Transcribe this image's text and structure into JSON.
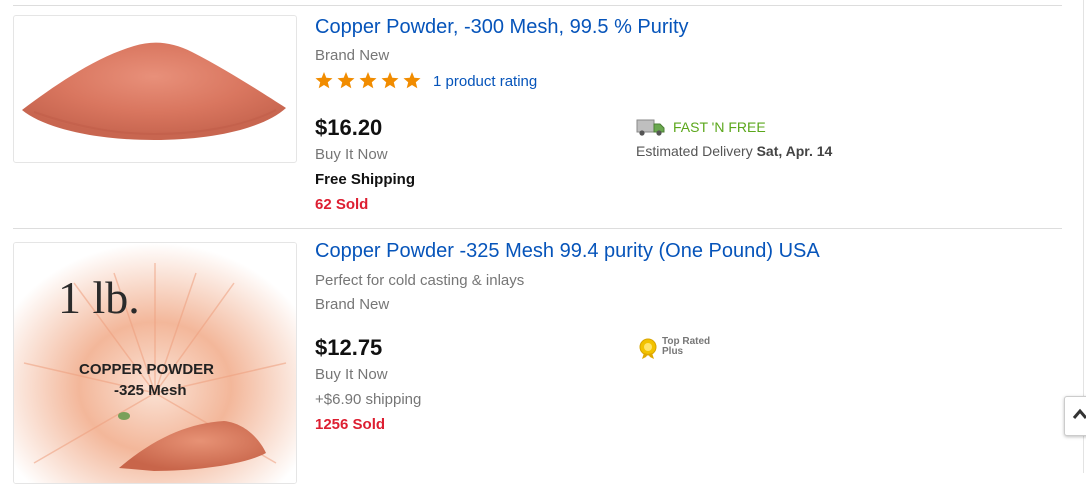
{
  "listings": [
    {
      "title": "Copper Powder, -300 Mesh, 99.5 % Purity",
      "condition": "Brand New",
      "rating_stars": 5,
      "rating_text": "1 product rating",
      "price": "$16.20",
      "format": "Buy It Now",
      "shipping": "Free Shipping",
      "sold": "62 Sold",
      "fast_label": "FAST 'N FREE",
      "delivery_prefix": "Estimated Delivery",
      "delivery_date": "Sat, Apr. 14"
    },
    {
      "title": "Copper Powder -325 Mesh 99.4 purity (One Pound) USA",
      "subtitle": "Perfect for cold casting & inlays",
      "condition": "Brand New",
      "price": "$12.75",
      "format": "Buy It Now",
      "shipping": "+$6.90 shipping",
      "sold": "1256 Sold",
      "badge_line1": "Top Rated",
      "badge_line2": "Plus",
      "image_text": {
        "weight": "1 lb.",
        "product": "COPPER POWDER",
        "mesh": "-325 Mesh"
      }
    }
  ],
  "colors": {
    "link": "#0654ba",
    "sold": "#dd1e31",
    "star": "#f18c00",
    "fast": "#5ba71b"
  },
  "icons": [
    "truck-icon",
    "top-rated-seal-icon",
    "star-icon",
    "scroll-up-icon"
  ]
}
